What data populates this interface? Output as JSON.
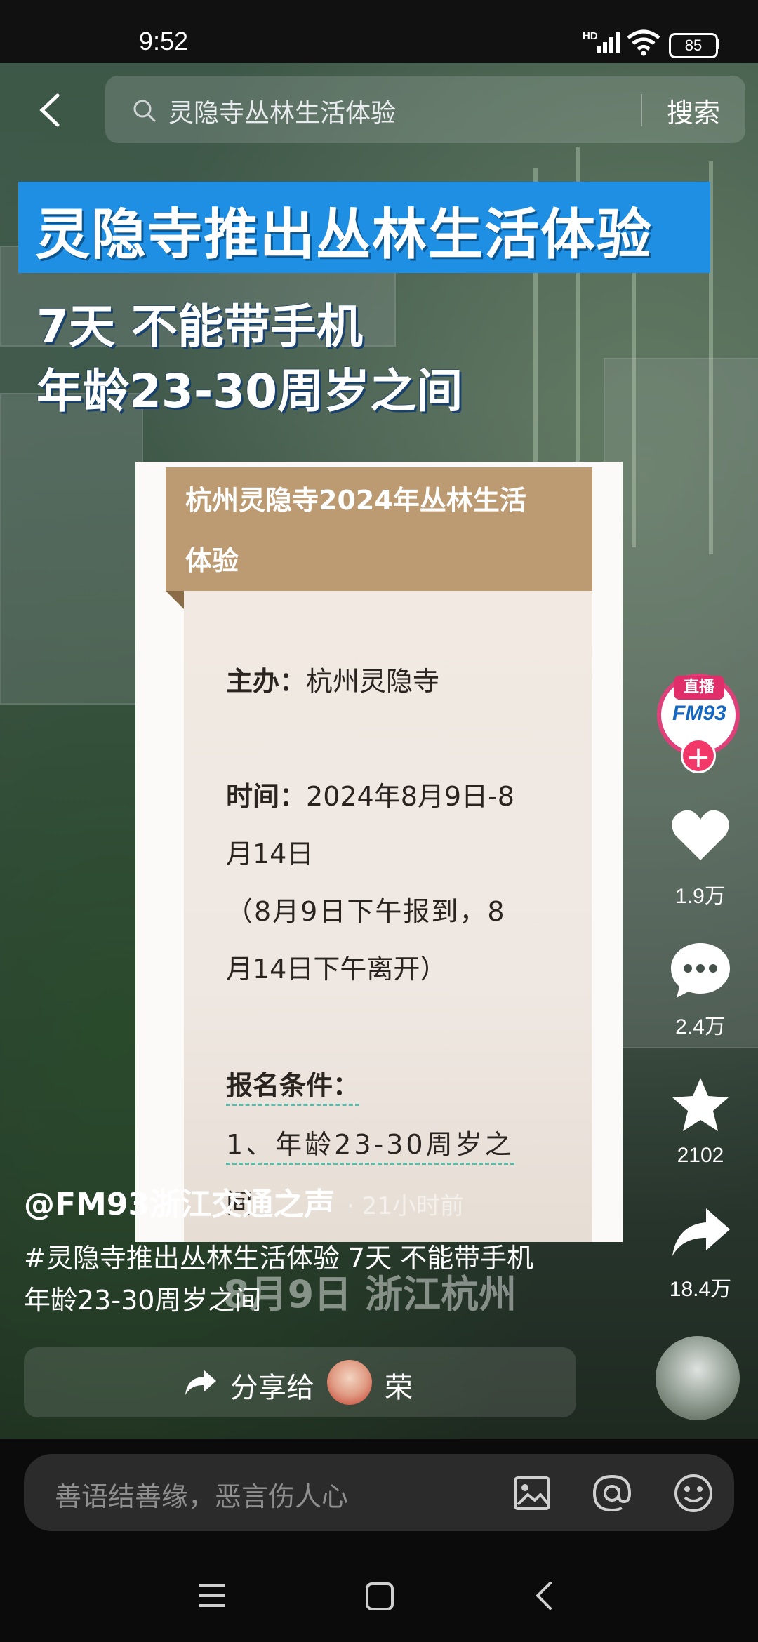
{
  "status_bar": {
    "time": "9:52",
    "network": "HD",
    "battery": "85"
  },
  "search": {
    "query": "灵隐寺丛林生活体验",
    "button": "搜索"
  },
  "overlay": {
    "headline": "灵隐寺推出丛林生活体验",
    "line1": "7天 不能带手机",
    "line2": "年龄23-30周岁之间"
  },
  "card": {
    "title_line1": "杭州灵隐寺2024年丛林生活",
    "title_line2": "体验",
    "organizer_label": "主办：",
    "organizer_value": "杭州灵隐寺",
    "time_label": "时间：",
    "time_value_1": "2024年8月9日-8",
    "time_value_2": "月14日",
    "time_note_1": "（8月9日下午报到，8",
    "time_note_2": "月14日下午离开）",
    "requirements_label": "报名条件：",
    "requirement_1": "1、年龄23-30周岁之",
    "requirement_1_cont": "间"
  },
  "watermark": "8月9日 浙江杭州",
  "actions": {
    "live_badge": "直播",
    "likes": "1.9万",
    "comments": "2.4万",
    "favorites": "2102",
    "shares": "18.4万"
  },
  "caption": {
    "author": "@FM93浙江交通之声",
    "time_ago": "· 21小时前",
    "desc_line1": "#灵隐寺推出丛林生活体验 7天 不能带手机",
    "desc_line2": "年龄23-30周岁之间"
  },
  "share": {
    "label": "分享给",
    "contact": "荣"
  },
  "comment": {
    "placeholder": "善语结善缘，恶言伤人心"
  },
  "colors": {
    "accent_blue": "#1f8fe4",
    "card_header": "#bc9b73",
    "live_pink": "#e02e6a"
  }
}
